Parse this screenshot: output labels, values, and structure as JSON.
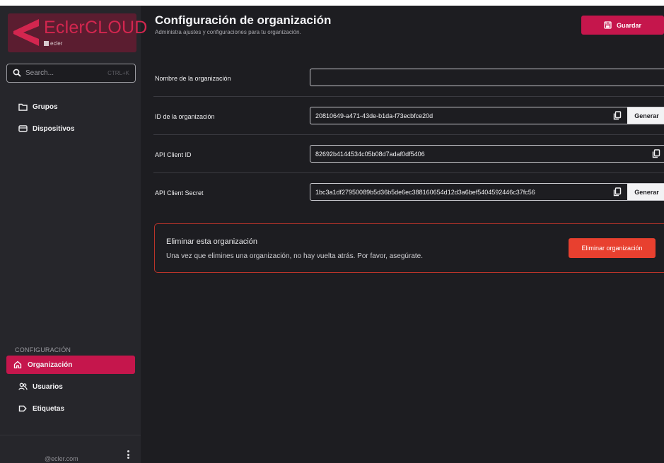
{
  "brand": {
    "name": "EclerCLOUD",
    "sub": "ecler",
    "accent": "#c5164c",
    "logo_bg": "#5b1d30"
  },
  "search": {
    "placeholder": "Search...",
    "shortcut": "CTRL+K"
  },
  "sidebar": {
    "items": [
      {
        "label": "Grupos",
        "icon": "folder-icon"
      },
      {
        "label": "Dispositivos",
        "icon": "device-icon"
      }
    ],
    "section_label": "CONFIGURACIÓN",
    "settings_items": [
      {
        "label": "Organización",
        "icon": "home-icon",
        "active": true
      },
      {
        "label": "Usuarios",
        "icon": "users-icon",
        "active": false
      },
      {
        "label": "Etiquetas",
        "icon": "tag-icon",
        "active": false
      }
    ],
    "user_email": "@ecler.com"
  },
  "header": {
    "title": "Configuración de organización",
    "subtitle": "Administra ajustes y configuraciones para tu organización.",
    "save_label": "Guardar"
  },
  "form": {
    "name": {
      "label": "Nombre de la organización",
      "value": ""
    },
    "org_id": {
      "label": "ID de la organización",
      "value": "20810649-a471-43de-b1da-f73ecbfce20d",
      "action": "Generar"
    },
    "client_id": {
      "label": "API Client ID",
      "value": "82692b4144534c05b08d7adaf0df5406"
    },
    "client_secret": {
      "label": "API Client Secret",
      "value": "1bc3a1df27950089b5d36b5de6ec388160654d12d3a6bef5404592446c37fc56",
      "action": "Generar"
    }
  },
  "danger": {
    "title": "Eliminar esta organización",
    "description": "Una vez que elimines una organización, no hay vuelta atrás. Por favor, asegúrate.",
    "button_label": "Eliminar organización",
    "color": "#e8402f"
  }
}
